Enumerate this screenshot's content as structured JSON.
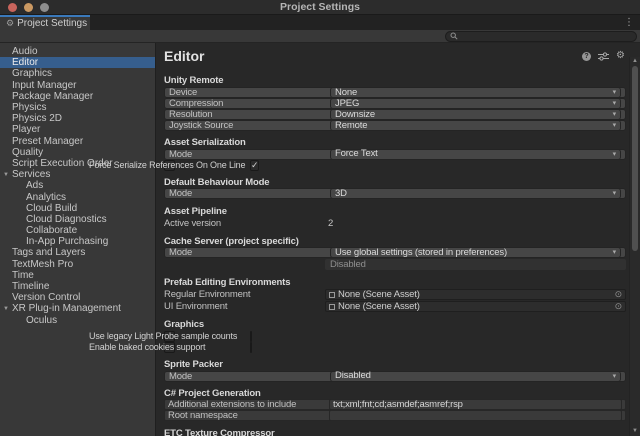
{
  "window": {
    "title": "Project Settings"
  },
  "tabbar": {
    "tab_label": "Project Settings"
  },
  "toolbar": {
    "search_placeholder": ""
  },
  "icons": {
    "foldout_open": "▼",
    "dropdown_arrow": "▾",
    "check": "✓",
    "kebab": "⋮",
    "gear": "⚙",
    "help": "?",
    "object_picker": "⊙",
    "scroll_up": "▲",
    "scroll_down": "▼"
  },
  "colors": {
    "accent_blue": "#3a79bb",
    "selection_blue": "#365e8d",
    "sidebar_bg": "#383838",
    "panel_bg": "#282828"
  },
  "sidebar": {
    "items": [
      {
        "label": "Audio",
        "indent": 0,
        "foldout": false,
        "selected": false
      },
      {
        "label": "Editor",
        "indent": 0,
        "foldout": false,
        "selected": true
      },
      {
        "label": "Graphics",
        "indent": 0,
        "foldout": false,
        "selected": false
      },
      {
        "label": "Input Manager",
        "indent": 0,
        "foldout": false,
        "selected": false
      },
      {
        "label": "Package Manager",
        "indent": 0,
        "foldout": false,
        "selected": false
      },
      {
        "label": "Physics",
        "indent": 0,
        "foldout": false,
        "selected": false
      },
      {
        "label": "Physics 2D",
        "indent": 0,
        "foldout": false,
        "selected": false
      },
      {
        "label": "Player",
        "indent": 0,
        "foldout": false,
        "selected": false
      },
      {
        "label": "Preset Manager",
        "indent": 0,
        "foldout": false,
        "selected": false
      },
      {
        "label": "Quality",
        "indent": 0,
        "foldout": false,
        "selected": false
      },
      {
        "label": "Script Execution Order",
        "indent": 0,
        "foldout": false,
        "selected": false
      },
      {
        "label": "Services",
        "indent": 0,
        "foldout": true,
        "selected": false
      },
      {
        "label": "Ads",
        "indent": 1,
        "foldout": false,
        "selected": false
      },
      {
        "label": "Analytics",
        "indent": 1,
        "foldout": false,
        "selected": false
      },
      {
        "label": "Cloud Build",
        "indent": 1,
        "foldout": false,
        "selected": false
      },
      {
        "label": "Cloud Diagnostics",
        "indent": 1,
        "foldout": false,
        "selected": false
      },
      {
        "label": "Collaborate",
        "indent": 1,
        "foldout": false,
        "selected": false
      },
      {
        "label": "In-App Purchasing",
        "indent": 1,
        "foldout": false,
        "selected": false
      },
      {
        "label": "Tags and Layers",
        "indent": 0,
        "foldout": false,
        "selected": false
      },
      {
        "label": "TextMesh Pro",
        "indent": 0,
        "foldout": false,
        "selected": false
      },
      {
        "label": "Time",
        "indent": 0,
        "foldout": false,
        "selected": false
      },
      {
        "label": "Timeline",
        "indent": 0,
        "foldout": false,
        "selected": false
      },
      {
        "label": "Version Control",
        "indent": 0,
        "foldout": false,
        "selected": false
      },
      {
        "label": "XR Plug-in Management",
        "indent": 0,
        "foldout": true,
        "selected": false
      },
      {
        "label": "Oculus",
        "indent": 1,
        "foldout": false,
        "selected": false
      }
    ]
  },
  "main": {
    "title": "Editor",
    "rows": [
      {
        "type": "section",
        "label": "Unity Remote"
      },
      {
        "type": "dropdown",
        "label": "Device",
        "value": "None"
      },
      {
        "type": "dropdown",
        "label": "Compression",
        "value": "JPEG"
      },
      {
        "type": "dropdown",
        "label": "Resolution",
        "value": "Downsize"
      },
      {
        "type": "dropdown",
        "label": "Joystick Source",
        "value": "Remote"
      },
      {
        "type": "section",
        "label": "Asset Serialization"
      },
      {
        "type": "dropdown",
        "label": "Mode",
        "value": "Force Text"
      },
      {
        "type": "checkbox",
        "label": "Force Serialize References On One Line",
        "checked": true
      },
      {
        "type": "section",
        "label": "Default Behaviour Mode"
      },
      {
        "type": "dropdown",
        "label": "Mode",
        "value": "3D"
      },
      {
        "type": "section",
        "label": "Asset Pipeline"
      },
      {
        "type": "text",
        "label": "Active version",
        "value": "2"
      },
      {
        "type": "section",
        "label": "Cache Server (project specific)"
      },
      {
        "type": "dropdown",
        "label": "Mode",
        "value": "Use global settings (stored in preferences)"
      },
      {
        "type": "status",
        "label": "",
        "value": "Disabled"
      },
      {
        "type": "section",
        "label": "Prefab Editing Environments"
      },
      {
        "type": "object",
        "label": "Regular Environment",
        "value": "None (Scene Asset)"
      },
      {
        "type": "object",
        "label": "UI Environment",
        "value": "None (Scene Asset)"
      },
      {
        "type": "section",
        "label": "Graphics"
      },
      {
        "type": "checkbox",
        "label": "Use legacy Light Probe sample counts",
        "checked": false
      },
      {
        "type": "checkbox",
        "label": "Enable baked cookies support",
        "checked": false
      },
      {
        "type": "section",
        "label": "Sprite Packer"
      },
      {
        "type": "dropdown",
        "label": "Mode",
        "value": "Disabled"
      },
      {
        "type": "section",
        "label": "C# Project Generation"
      },
      {
        "type": "textfield",
        "label": "Additional extensions to include",
        "value": "txt;xml;fnt;cd;asmdef;asmref;rsp"
      },
      {
        "type": "textfield",
        "label": "Root namespace",
        "value": ""
      },
      {
        "type": "section",
        "label": "ETC Texture Compressor"
      }
    ]
  }
}
